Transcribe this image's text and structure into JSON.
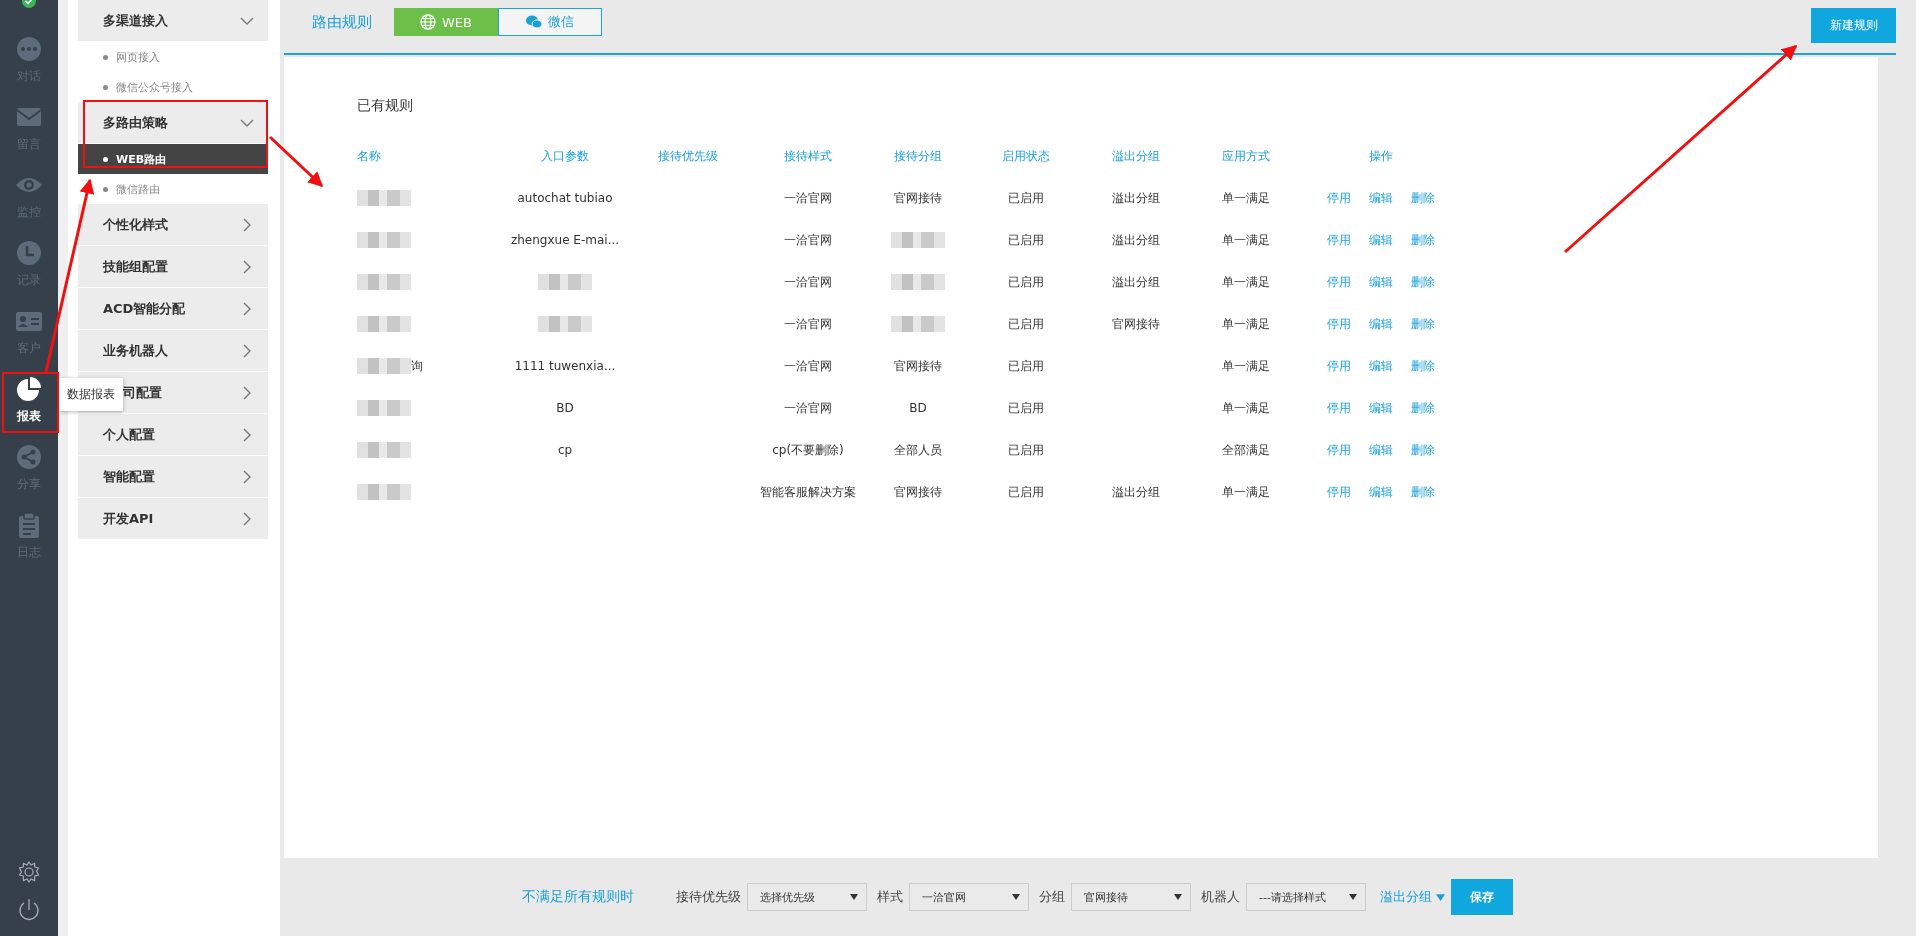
{
  "rail": {
    "status": {
      "online": true
    },
    "items": [
      {
        "kind": "chat",
        "label": "对话",
        "selected": false
      },
      {
        "kind": "mail",
        "label": "留言",
        "selected": false
      },
      {
        "kind": "eye",
        "label": "监控",
        "selected": false
      },
      {
        "kind": "clock",
        "label": "记录",
        "selected": false
      },
      {
        "kind": "card",
        "label": "客户",
        "selected": false
      },
      {
        "kind": "pie",
        "label": "报表",
        "selected": true
      },
      {
        "kind": "share",
        "label": "分享",
        "selected": false
      },
      {
        "kind": "clipboard",
        "label": "日志",
        "selected": false
      }
    ],
    "tooltip": "数据报表"
  },
  "menu": [
    {
      "label": "多渠道接入",
      "expanded": true,
      "children": [
        {
          "label": "网页接入",
          "selected": false
        },
        {
          "label": "微信公众号接入",
          "selected": false
        }
      ]
    },
    {
      "label": "多路由策略",
      "expanded": true,
      "children": [
        {
          "label": "WEB路由",
          "selected": true
        },
        {
          "label": "微信路由",
          "selected": false
        }
      ]
    },
    {
      "label": "个性化样式",
      "expanded": false
    },
    {
      "label": "技能组配置",
      "expanded": false
    },
    {
      "label": "ACD智能分配",
      "expanded": false
    },
    {
      "label": "业务机器人",
      "expanded": false
    },
    {
      "label": "司配置",
      "expanded": false,
      "under_tooltip": true
    },
    {
      "label": "个人配置",
      "expanded": false
    },
    {
      "label": "智能配置",
      "expanded": false
    },
    {
      "label": "开发API",
      "expanded": false
    }
  ],
  "header": {
    "title": "路由规则",
    "tabs": [
      {
        "kind": "globe",
        "label": "WEB",
        "selected": true
      },
      {
        "kind": "wechat",
        "label": "微信",
        "selected": false
      }
    ],
    "new_button": "新建规则"
  },
  "rules": {
    "title": "已有规则",
    "columns": [
      "名称",
      "入口参数",
      "接待优先级",
      "接待样式",
      "接待分组",
      "启用状态",
      "溢出分组",
      "应用方式",
      "操作"
    ],
    "rows": [
      {
        "cells": [
          {
            "kind": "blurred"
          },
          "autochat  tubiao",
          null,
          "一洽官网",
          "官网接待",
          "已启用",
          "溢出分组",
          "单一满足"
        ],
        "actions": [
          "停用",
          "编辑",
          "删除"
        ]
      },
      {
        "cells": [
          {
            "kind": "blurred"
          },
          "zhengxue E-mai...",
          null,
          "一洽官网",
          {
            "kind": "blurred"
          },
          "已启用",
          "溢出分组",
          "单一满足"
        ],
        "actions": [
          "停用",
          "编辑",
          "删除"
        ]
      },
      {
        "cells": [
          {
            "kind": "blurred"
          },
          {
            "kind": "blurred"
          },
          null,
          "一洽官网",
          {
            "kind": "blurred"
          },
          "已启用",
          "溢出分组",
          "单一满足"
        ],
        "actions": [
          "停用",
          "编辑",
          "删除"
        ]
      },
      {
        "cells": [
          {
            "kind": "blurred"
          },
          {
            "kind": "blurred"
          },
          null,
          "一洽官网",
          {
            "kind": "blurred"
          },
          "已启用",
          "官网接待",
          "单一满足"
        ],
        "actions": [
          "停用",
          "编辑",
          "删除"
        ]
      },
      {
        "cells": [
          {
            "kind": "blurred",
            "text": "询"
          },
          "1111  tuwenxia...",
          null,
          "一洽官网",
          "官网接待",
          "已启用",
          null,
          "单一满足"
        ],
        "actions": [
          "停用",
          "编辑",
          "删除"
        ]
      },
      {
        "cells": [
          {
            "kind": "blurred"
          },
          "BD",
          null,
          "一洽官网",
          "BD",
          "已启用",
          null,
          "单一满足"
        ],
        "actions": [
          "停用",
          "编辑",
          "删除"
        ]
      },
      {
        "cells": [
          {
            "kind": "blurred"
          },
          "cp",
          null,
          "cp(不要删除)",
          "全部人员",
          "已启用",
          null,
          "全部满足"
        ],
        "actions": [
          "停用",
          "编辑",
          "删除"
        ]
      },
      {
        "cells": [
          {
            "kind": "blurred"
          },
          null,
          null,
          "智能客服解决方案",
          "官网接待",
          "已启用",
          "溢出分组",
          "单一满足"
        ],
        "actions": [
          "停用",
          "编辑",
          "删除"
        ]
      }
    ]
  },
  "fallback": {
    "label": "不满足所有规则时",
    "fields": [
      {
        "label": "接待优先级",
        "value": "选择优先级"
      },
      {
        "label": "样式",
        "value": "一洽官网"
      },
      {
        "label": "分组",
        "value": "官网接待"
      },
      {
        "label": "机器人",
        "value": "---请选择样式"
      }
    ],
    "overflow_link": "溢出分组",
    "save_button": "保存"
  }
}
